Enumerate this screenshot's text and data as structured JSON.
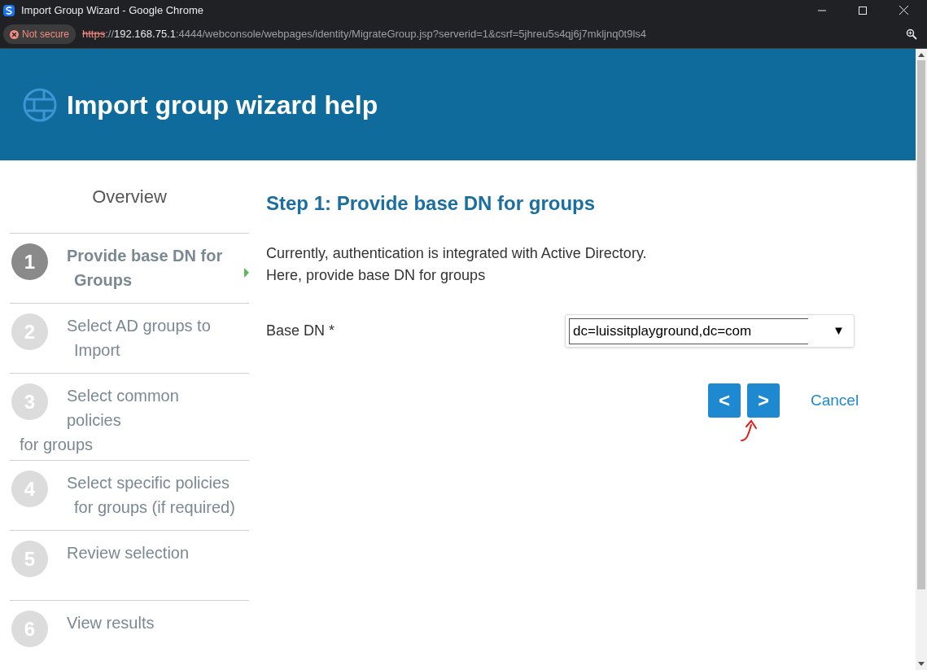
{
  "window": {
    "title": "Import Group Wizard - Google Chrome"
  },
  "address_bar": {
    "security": "Not secure",
    "scheme": "https",
    "separator": "://",
    "host": "192.168.75.1",
    "rest": ":4444/webconsole/webpages/identity/MigrateGroup.jsp?serverid=1&csrf=5jhreu5s4qj6j7mkljnq0t9ls4"
  },
  "header": {
    "title": "Import group wizard help"
  },
  "sidebar": {
    "title": "Overview",
    "steps": [
      {
        "number": "1",
        "lines": [
          "Provide base DN for",
          "Groups"
        ],
        "selected": true
      },
      {
        "number": "2",
        "lines": [
          "Select AD groups to",
          "Import"
        ],
        "selected": false
      },
      {
        "number": "3",
        "lines": [
          "Select common",
          "policies",
          "for groups"
        ],
        "selected": false
      },
      {
        "number": "4",
        "lines": [
          "Select specific policies",
          "for groups (if required)"
        ],
        "selected": false
      },
      {
        "number": "5",
        "lines": [
          "Review selection"
        ],
        "selected": false
      },
      {
        "number": "6",
        "lines": [
          "View results"
        ],
        "selected": false
      }
    ]
  },
  "content": {
    "heading": "Step 1: Provide base DN for groups",
    "description_lines": [
      "Currently, authentication is integrated with Active Directory.",
      "Here, provide base DN for groups"
    ],
    "field": {
      "label": "Base DN *",
      "value": "dc=luissitplayground,dc=com",
      "arrow": "▼"
    },
    "buttons": {
      "back": "<",
      "next": ">",
      "cancel": "Cancel"
    }
  }
}
